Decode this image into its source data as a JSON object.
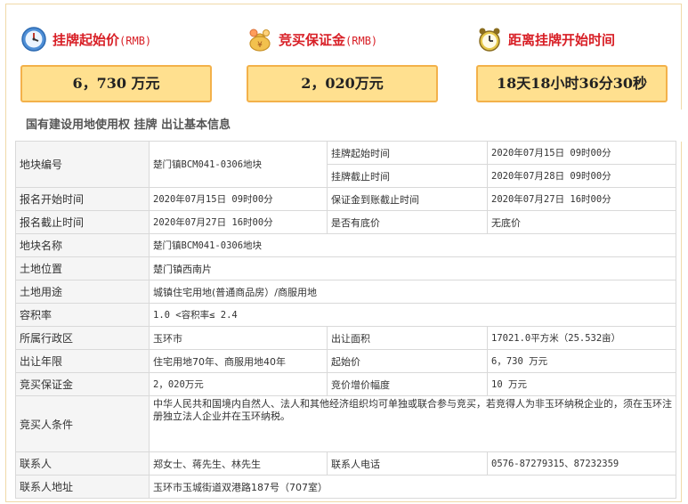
{
  "summary": {
    "start_price": {
      "label": "挂牌起始价",
      "unit": "(RMB)",
      "value": "6，730 万元",
      "icon": "clock-icon"
    },
    "deposit": {
      "label": "竞买保证金",
      "unit": "(RMB)",
      "value": "2，020万元",
      "icon": "money-bag-icon"
    },
    "countdown": {
      "label": "距离挂牌开始时间",
      "value": "18天18小时36分30秒",
      "icon": "alarm-clock-icon"
    }
  },
  "section_title": "国有建设用地使用权 挂牌 出让基本信息",
  "info": {
    "parcel_no": {
      "label": "地块编号",
      "value": "楚门镇BCM041-0306地块"
    },
    "listing_start": {
      "label": "挂牌起始时间",
      "value": "2020年07月15日 09时00分"
    },
    "listing_end": {
      "label": "挂牌截止时间",
      "value": "2020年07月28日 09时00分"
    },
    "reg_start": {
      "label": "报名开始时间",
      "value": "2020年07月15日 09时00分"
    },
    "deposit_deadline": {
      "label": "保证金到账截止时间",
      "value": "2020年07月27日 16时00分"
    },
    "reg_end": {
      "label": "报名截止时间",
      "value": "2020年07月27日 16时00分"
    },
    "reserve_price": {
      "label": "是否有底价",
      "value": "无底价"
    },
    "parcel_name": {
      "label": "地块名称",
      "value": "楚门镇BCM041-0306地块"
    },
    "location": {
      "label": "土地位置",
      "value": "楚门镇西南片"
    },
    "usage": {
      "label": "土地用途",
      "value": "城镇住宅用地(普通商品房）/商服用地"
    },
    "far": {
      "label": "容积率",
      "value": "1.0 <容积率≤ 2.4"
    },
    "district": {
      "label": "所属行政区",
      "value": "玉环市"
    },
    "area": {
      "label": "出让面积",
      "value": "17021.0平方米（25.532亩）"
    },
    "term": {
      "label": "出让年限",
      "value": "住宅用地70年、商服用地40年"
    },
    "start_price": {
      "label": "起始价",
      "value": "6，730 万元"
    },
    "deposit": {
      "label": "竞买保证金",
      "value": "2，020万元"
    },
    "increment": {
      "label": "竞价增价幅度",
      "value": "10 万元"
    },
    "conditions": {
      "label": "竞买人条件",
      "value": "中华人民共和国境内自然人、法人和其他经济组织均可单独或联合参与竞买，若竞得人为非玉环纳税企业的，须在玉环注册独立法人企业并在玉环纳税。"
    },
    "contact": {
      "label": "联系人",
      "value": "郑女士、蒋先生、林先生"
    },
    "phone": {
      "label": "联系人电话",
      "value": "0576-87279315、87232359"
    },
    "address": {
      "label": "联系人地址",
      "value": "玉环市玉城街道双港路187号（707室）"
    }
  }
}
